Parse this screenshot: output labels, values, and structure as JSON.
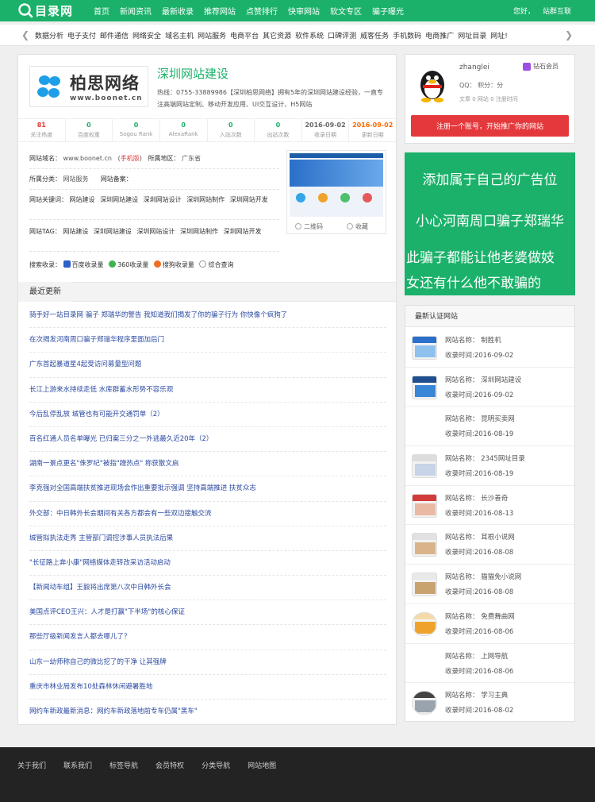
{
  "brand": {
    "name": "目录网",
    "color": "#1bb16a"
  },
  "nav": {
    "items": [
      "首页",
      "新闻资讯",
      "最新收录",
      "推荐网站",
      "点赞排行",
      "快审网站",
      "软文专区",
      "骗子曝光"
    ],
    "greeting": "您好，",
    "greeting_link": "站群互联"
  },
  "categories": [
    "数据分析",
    "电子支付",
    "邮件通信",
    "网络安全",
    "域名主机",
    "网站服务",
    "电商平台",
    "其它资源",
    "软件系统",
    "口碑评测",
    "威客任务",
    "手机数码",
    "电商推广",
    "网址目录",
    "网址!"
  ],
  "site": {
    "logo_cn": "柏思网络",
    "logo_url": "www.boonet.cn",
    "title": "深圳网站建设",
    "description": "热线：0755-33889986【深圳柏思网络】拥有5年的深圳网站建设经验，一直专注高端网站定制、移动开发应用、UI交互设计、H5网站",
    "stats": [
      {
        "value": "81",
        "label": "关注热度",
        "tone": "red"
      },
      {
        "value": "0",
        "label": "百度权重",
        "tone": "green"
      },
      {
        "value": "0",
        "label": "Sogou Rank",
        "tone": "green"
      },
      {
        "value": "0",
        "label": "AlexaRank",
        "tone": "green"
      },
      {
        "value": "0",
        "label": "入站次数",
        "tone": "green"
      },
      {
        "value": "0",
        "label": "出站次数",
        "tone": "green"
      },
      {
        "value": "2016-09-02",
        "label": "收录日期",
        "tone": "grey"
      },
      {
        "value": "2016-09-02",
        "label": "更新日期",
        "tone": "orange"
      }
    ],
    "info": {
      "url_label": "网站域名：",
      "url_value": "www.boonet.cn",
      "mobile": "手机版",
      "region_label": "所属地区：",
      "region_value": "广东省",
      "category_label": "所属分类：",
      "category_value": "网站服务",
      "icp_label": "网站备案：",
      "keywords_label": "网站关键词：",
      "keywords": [
        "网站建设",
        "深圳网站建设",
        "深圳网站设计",
        "深圳网站制作",
        "深圳网站开发"
      ],
      "tags_label": "网站TAG：",
      "tags": [
        "网站建设",
        "深圳网站建设",
        "深圳网站设计",
        "深圳网站制作",
        "深圳网站开发"
      ],
      "search_label": "搜索收录：",
      "search": [
        "百度收录量",
        "360收录量",
        "搜狗收录量",
        "综合查询"
      ]
    },
    "preview": {
      "qr_label": "二维码",
      "fav_label": "收藏"
    }
  },
  "recent": {
    "tab": "最近更新",
    "items": [
      "骑手好一站目录网 骗子 郑瑞华的警告 我知道我们揭发了你的骗子行为 你快像个疯狗了",
      "在次揭发河南周口骗子郑瑞华程序里面加后门",
      "广东首起暴道星4起受访问募量型问题",
      "长江上游来水持续走低 水库群蓄水形势不容乐观",
      "今后乱停乱放 城管也有可能开交通罚单（2）",
      "百名红通人员名单曝光 已归案三分之一外逃最久近20年（2）",
      "湖南一景点更名\"侏罗纪\"被指\"蹭热点\" 称获散文启",
      "李克强对全国高端扶贫推进现场会作出重要批示强调 坚持高端推进 扶贫众志",
      "外交部：中日韩外长会期间有关各方都会有一些双边接触交流",
      "城管拟执法走秀 主管部门调控涉事人员执法后果",
      "\"长征路上奔小康\"网络媒体走转改采访活动启动",
      "【新闻动车组】王毅将出席第八次中日韩外长会",
      "美国点评CEO王兴：人才是打赢\"下半场\"的核心保证",
      "那些厅级新闻发言人都去哪儿了？",
      "山东一幼师称自己的微比挖了的干净 让其强牌",
      "重庆市林业局发布10处森林休闲避暑胜地",
      "网约车新政最新消息：网约车新政落地前专车仍属\"黑车\""
    ]
  },
  "user": {
    "name": "zhanglei",
    "vip": "钻石会员",
    "qq_line": "QQ：  积分：分",
    "article_line": "文章 0  网站 0  注册时间",
    "register_button": "注册一个账号，开始推广你的网站"
  },
  "ad": {
    "line1": "添加属于自己的广告位",
    "line2": "小心河南周口骗子郑瑞华",
    "line3": "此骗子都能让他老婆做妓",
    "line4": "女还有什么他不敢骗的"
  },
  "certified": {
    "title": "最新认证网站",
    "items": [
      {
        "name": "网站名称：  制胜机",
        "date": "收录时间:2016-09-02"
      },
      {
        "name": "网站名称：  深圳网站建设",
        "date": "收录时间:2016-09-02"
      },
      {
        "name": "网站名称：  昆明买卖网",
        "date": "收录时间:2016-08-19"
      },
      {
        "name": "网站名称：  2345网址目录",
        "date": "收录时间:2016-08-19"
      },
      {
        "name": "网站名称：  长沙善奇",
        "date": "收录时间:2016-08-13"
      },
      {
        "name": "网站名称：  耳根小说网",
        "date": "收录时间:2016-08-08"
      },
      {
        "name": "网站名称：  猫猫免小说网",
        "date": "收录时间:2016-08-08"
      },
      {
        "name": "网站名称：  免费舞曲网",
        "date": "收录时间:2016-08-06"
      },
      {
        "name": "网站名称：  上网导航",
        "date": "收录时间:2016-08-06"
      },
      {
        "name": "网站名称：  学习主典",
        "date": "收录时间:2016-08-02"
      }
    ]
  },
  "footer": {
    "links": [
      "关于我们",
      "联系我们",
      "标签导航",
      "会员特权",
      "分类导航",
      "网站地图"
    ]
  }
}
